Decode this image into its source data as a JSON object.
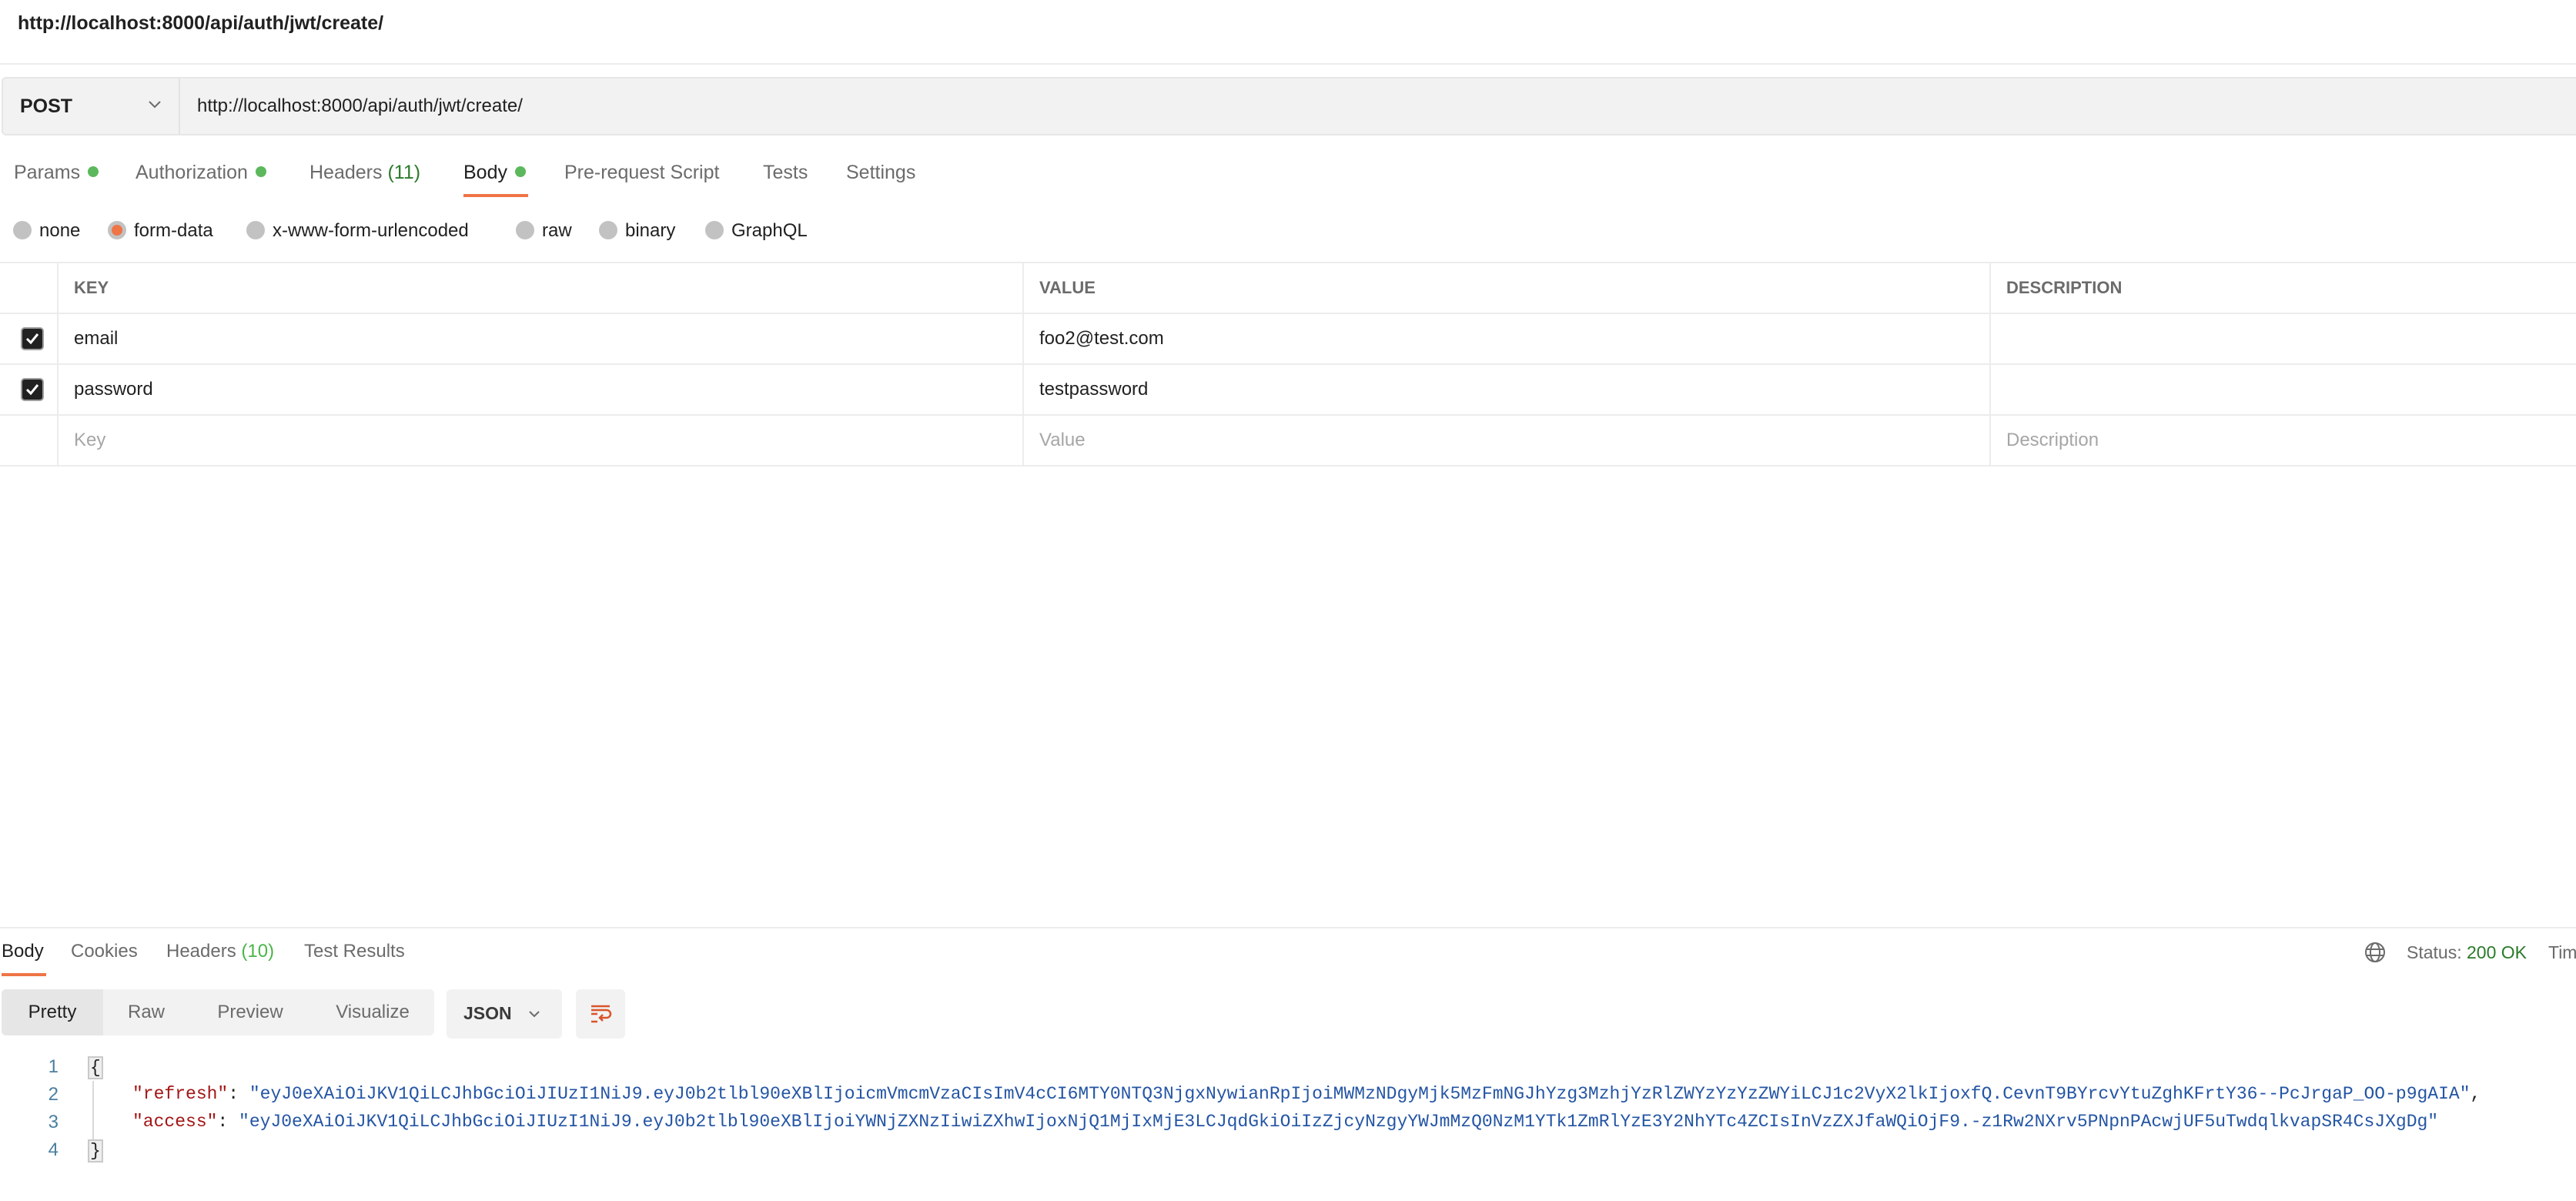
{
  "window": {
    "title": "http://localhost:8000/api/auth/jwt/create/"
  },
  "request": {
    "method": "POST",
    "url": "http://localhost:8000/api/auth/jwt/create/",
    "tabs": [
      {
        "label": "Params",
        "indicator": "dot"
      },
      {
        "label": "Authorization",
        "indicator": "dot"
      },
      {
        "label": "Headers",
        "count": "(11)"
      },
      {
        "label": "Body",
        "indicator": "dot",
        "active": true
      },
      {
        "label": "Pre-request Script"
      },
      {
        "label": "Tests"
      },
      {
        "label": "Settings"
      }
    ],
    "body_types": [
      {
        "label": "none"
      },
      {
        "label": "form-data",
        "selected": true
      },
      {
        "label": "x-www-form-urlencoded"
      },
      {
        "label": "raw"
      },
      {
        "label": "binary"
      },
      {
        "label": "GraphQL"
      }
    ],
    "table": {
      "headers": {
        "key": "KEY",
        "value": "VALUE",
        "description": "DESCRIPTION"
      },
      "rows": [
        {
          "checked": true,
          "key": "email",
          "value": "foo2@test.com",
          "description": ""
        },
        {
          "checked": true,
          "key": "password",
          "value": "testpassword",
          "description": ""
        }
      ],
      "placeholders": {
        "key": "Key",
        "value": "Value",
        "description": "Description"
      }
    }
  },
  "response": {
    "tabs": [
      {
        "label": "Body",
        "active": true
      },
      {
        "label": "Cookies"
      },
      {
        "label": "Headers",
        "count": "(10)"
      },
      {
        "label": "Test Results"
      }
    ],
    "status_label": "Status:",
    "status_value": "200 OK",
    "time_label": "Tim",
    "view_modes": [
      "Pretty",
      "Raw",
      "Preview",
      "Visualize"
    ],
    "active_view": "Pretty",
    "format": "JSON",
    "lines": [
      {
        "n": "1",
        "open": "{"
      },
      {
        "n": "2",
        "key": "\"refresh\"",
        "value": "\"eyJ0eXAiOiJKV1QiLCJhbGciOiJIUzI1NiJ9.eyJ0b2tlbl90eXBlIjoicmVmcmVzaCIsImV4cCI6MTY0NTQ3NjgxNywianRpIjoiMWMzNDgyMjk5MzFmNGJhYzg3MzhjYzRlZWYzYzYzZWYiLCJ1c2VyX2lkIjoxfQ.CevnT9BYrcvYtuZghKFrtY36--PcJrgaP_OO-p9gAIA\"",
        "trail": ","
      },
      {
        "n": "3",
        "key": "\"access\"",
        "value": "\"eyJ0eXAiOiJKV1QiLCJhbGciOiJIUzI1NiJ9.eyJ0b2tlbl90eXBlIjoiYWNjZXNzIiwiZXhwIjoxNjQ1MjIxMjE3LCJqdGkiOiIzZjcyNzgyYWJmMzQ0NzM1YTk1ZmRlYzE3Y2NhYTc4ZCIsInVzZXJfaWQiOjF9.-z1Rw2NXrv5PNpnPAcwjUF5uTwdqlkvapSR4CsJXgDg\""
      },
      {
        "n": "4",
        "close": "}"
      }
    ]
  },
  "colors": {
    "accent": "#ef7446",
    "success": "#2b7a2b",
    "indicator_dot": "#5cb85c",
    "json_key": "#a31515",
    "json_string": "#2455a4"
  }
}
